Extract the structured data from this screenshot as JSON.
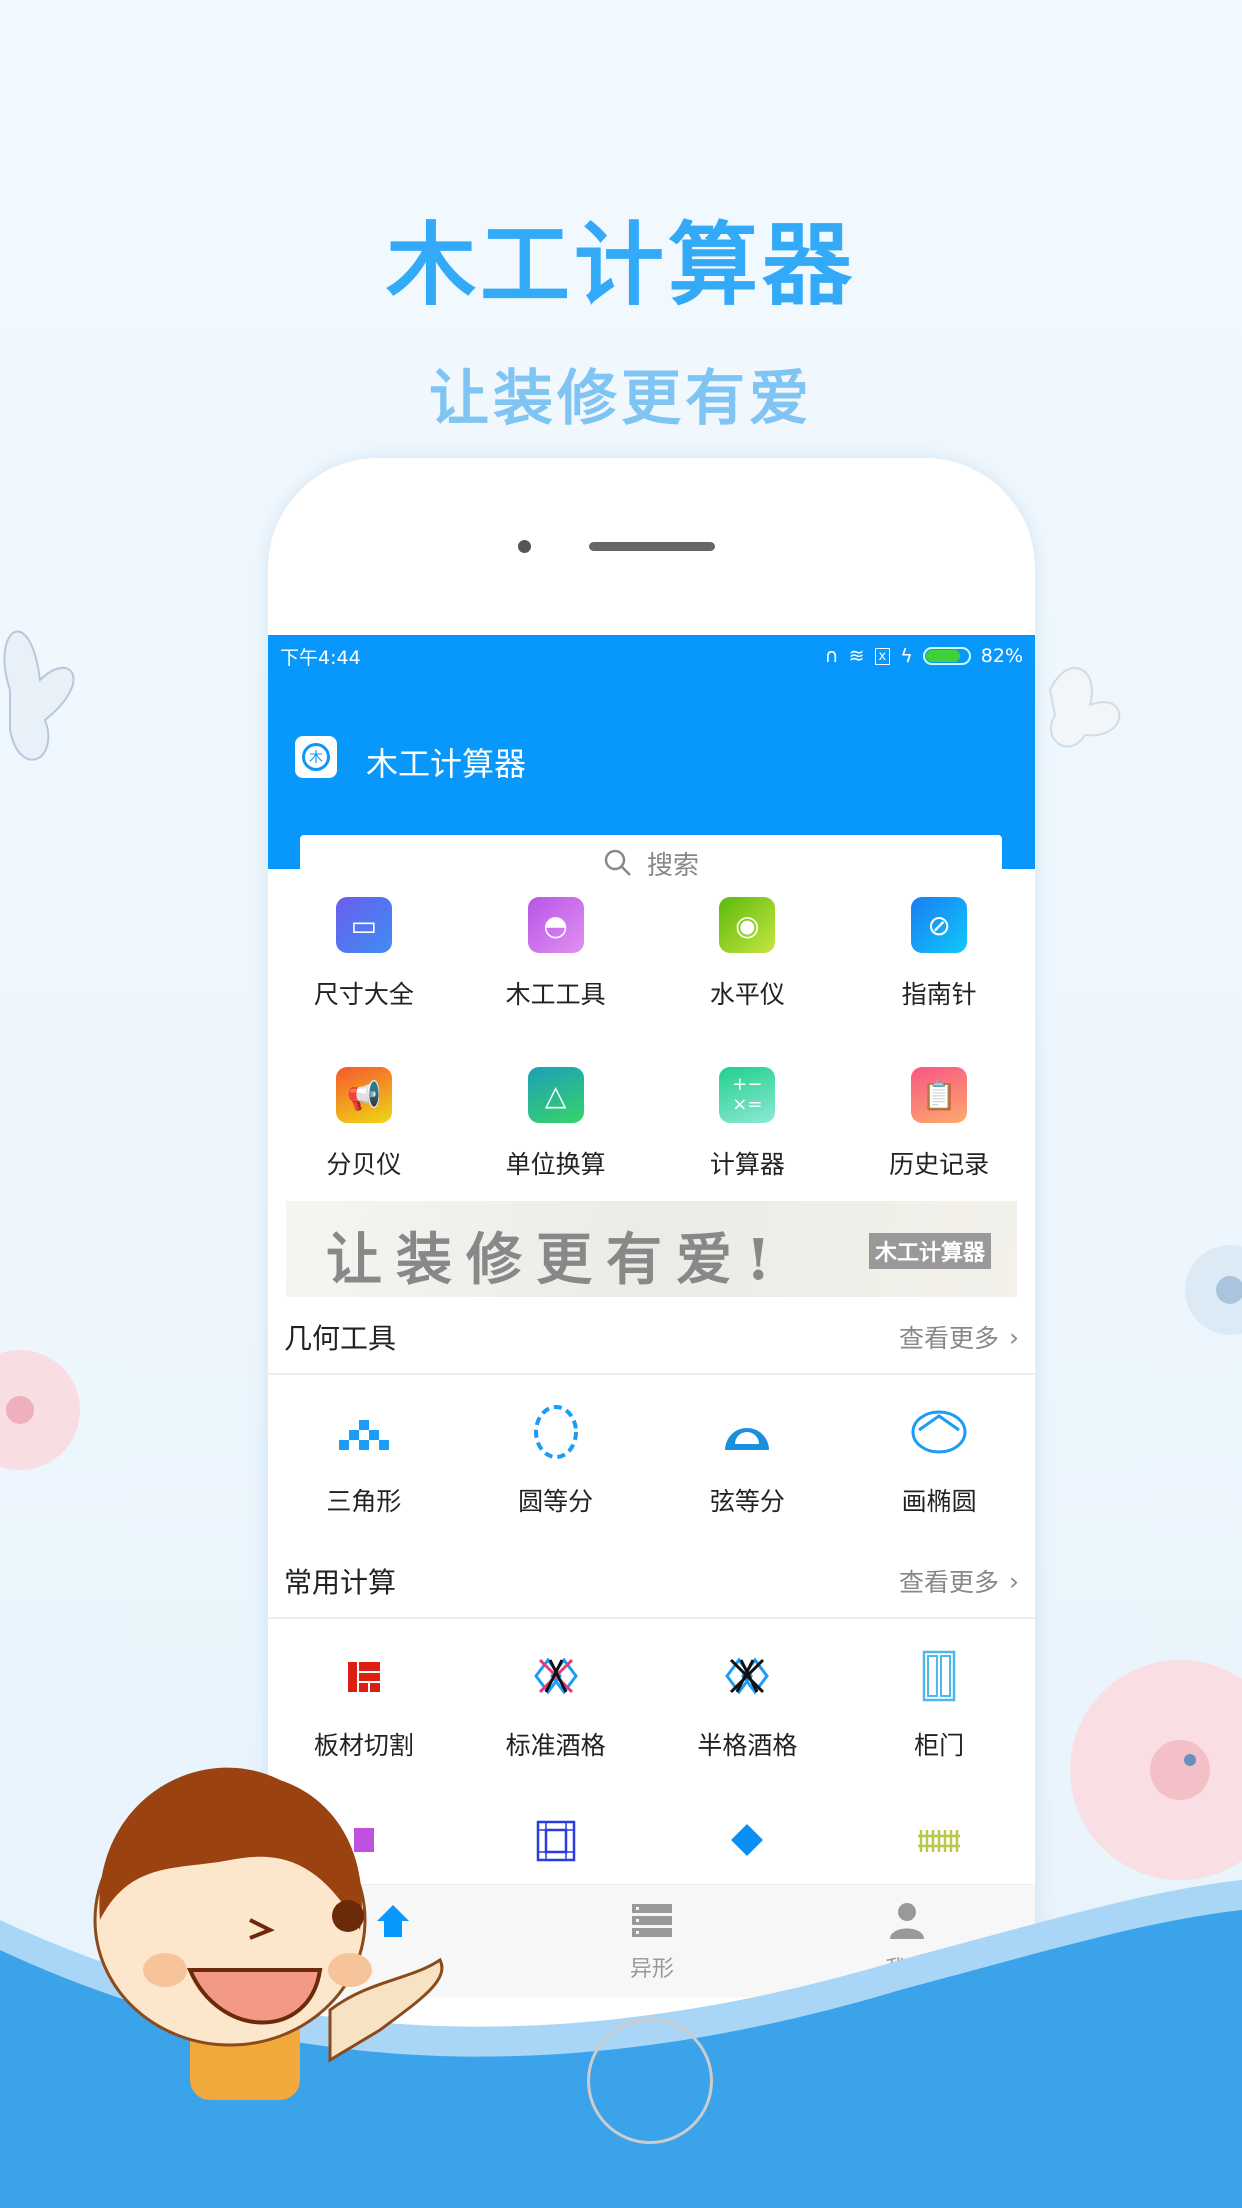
{
  "hero": {
    "title": "木工计算器",
    "subtitle": "让装修更有爱"
  },
  "status_bar": {
    "time": "下午4:44",
    "battery": "82%",
    "battery_level": 0.82,
    "icons": [
      "headset-icon",
      "wifi-icon",
      "no-sim-icon",
      "charging-icon",
      "battery-icon"
    ]
  },
  "app_bar": {
    "title": "木工计算器",
    "logo_char": "木",
    "search_placeholder": "搜索"
  },
  "tools": [
    {
      "label": "尺寸大全",
      "icon": "ruler-icon",
      "color": "#5a6cf0"
    },
    {
      "label": "木工工具",
      "icon": "protractor-icon",
      "color": "#c668e6"
    },
    {
      "label": "水平仪",
      "icon": "level-icon",
      "color": "#7cc71e"
    },
    {
      "label": "指南针",
      "icon": "compass-icon",
      "color": "#1a9cf7"
    },
    {
      "label": "分贝仪",
      "icon": "megaphone-icon",
      "color": "#f78c2a"
    },
    {
      "label": "单位换算",
      "icon": "recycle-icon",
      "color": "#22b89a"
    },
    {
      "label": "计算器",
      "icon": "calculator-icon",
      "color": "#2dd49a"
    },
    {
      "label": "历史记录",
      "icon": "clipboard-icon",
      "color": "#f7697a"
    }
  ],
  "banner": {
    "slogan": "让装修更有爱!",
    "tag": "木工计算器"
  },
  "sections": [
    {
      "title": "几何工具",
      "more": "查看更多",
      "items": [
        {
          "label": "三角形",
          "icon": "triangle-blocks-icon"
        },
        {
          "label": "圆等分",
          "icon": "dashed-circle-icon"
        },
        {
          "label": "弦等分",
          "icon": "semicircle-ruler-icon"
        },
        {
          "label": "画椭圆",
          "icon": "ellipse-icon"
        }
      ]
    },
    {
      "title": "常用计算",
      "more": "查看更多",
      "items": [
        {
          "label": "板材切割",
          "icon": "board-cut-icon"
        },
        {
          "label": "标准酒格",
          "icon": "wine-rack-icon"
        },
        {
          "label": "半格酒格",
          "icon": "half-wine-rack-icon"
        },
        {
          "label": "柜门",
          "icon": "cabinet-door-icon"
        },
        {
          "label": "",
          "icon": "purple-partial-icon"
        },
        {
          "label": "",
          "icon": "grid-frame-icon"
        },
        {
          "label": "",
          "icon": "diamond-icon"
        },
        {
          "label": "",
          "icon": "fence-icon"
        }
      ]
    }
  ],
  "bottom_nav": [
    {
      "label": "",
      "icon": "home-icon"
    },
    {
      "label": "异形",
      "icon": "list-icon"
    },
    {
      "label": "我的",
      "icon": "user-icon"
    }
  ],
  "colors": {
    "primary": "#0898fb",
    "title": "#33aaf8",
    "subtitle": "#80c4f4",
    "wave": "#3ba3ea"
  }
}
